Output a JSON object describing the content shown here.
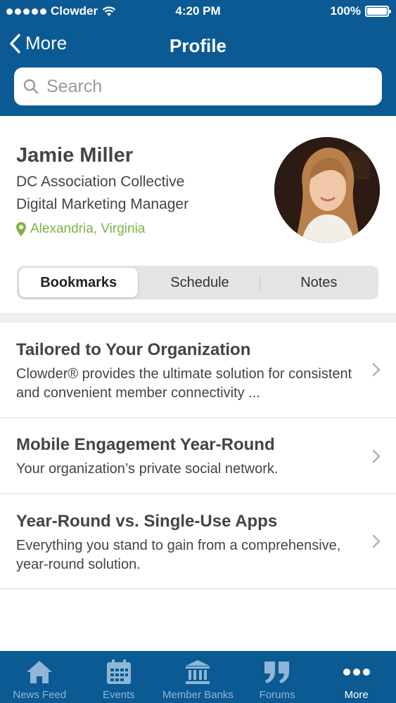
{
  "status": {
    "carrier": "Clowder",
    "time": "4:20 PM",
    "battery": "100%"
  },
  "nav": {
    "back_label": "More",
    "title": "Profile"
  },
  "search": {
    "placeholder": "Search"
  },
  "profile": {
    "name": "Jamie Miller",
    "organization": "DC Association Collective",
    "role": "Digital Marketing Manager",
    "location": "Alexandria, Virginia"
  },
  "segments": [
    {
      "label": "Bookmarks",
      "selected": true
    },
    {
      "label": "Schedule",
      "selected": false
    },
    {
      "label": "Notes",
      "selected": false
    }
  ],
  "items": [
    {
      "title": "Tailored to Your Organization",
      "description": "Clowder® provides the ultimate solution for consistent and convenient member connectivity ..."
    },
    {
      "title": "Mobile Engagement Year-Round",
      "description": "Your organization’s private social network."
    },
    {
      "title": "Year-Round vs. Single-Use Apps",
      "description": "Everything you stand to gain from a comprehensive, year-round solution."
    }
  ],
  "tabs": [
    {
      "label": "News Feed",
      "icon": "home-icon",
      "active": false
    },
    {
      "label": "Events",
      "icon": "calendar-icon",
      "active": false
    },
    {
      "label": "Member Banks",
      "icon": "bank-icon",
      "active": false
    },
    {
      "label": "Forums",
      "icon": "quote-icon",
      "active": false
    },
    {
      "label": "More",
      "icon": "more-icon",
      "active": true
    }
  ],
  "colors": {
    "brand": "#0b5a94",
    "location": "#7cb342",
    "tab_inactive": "#8fb6d6"
  }
}
